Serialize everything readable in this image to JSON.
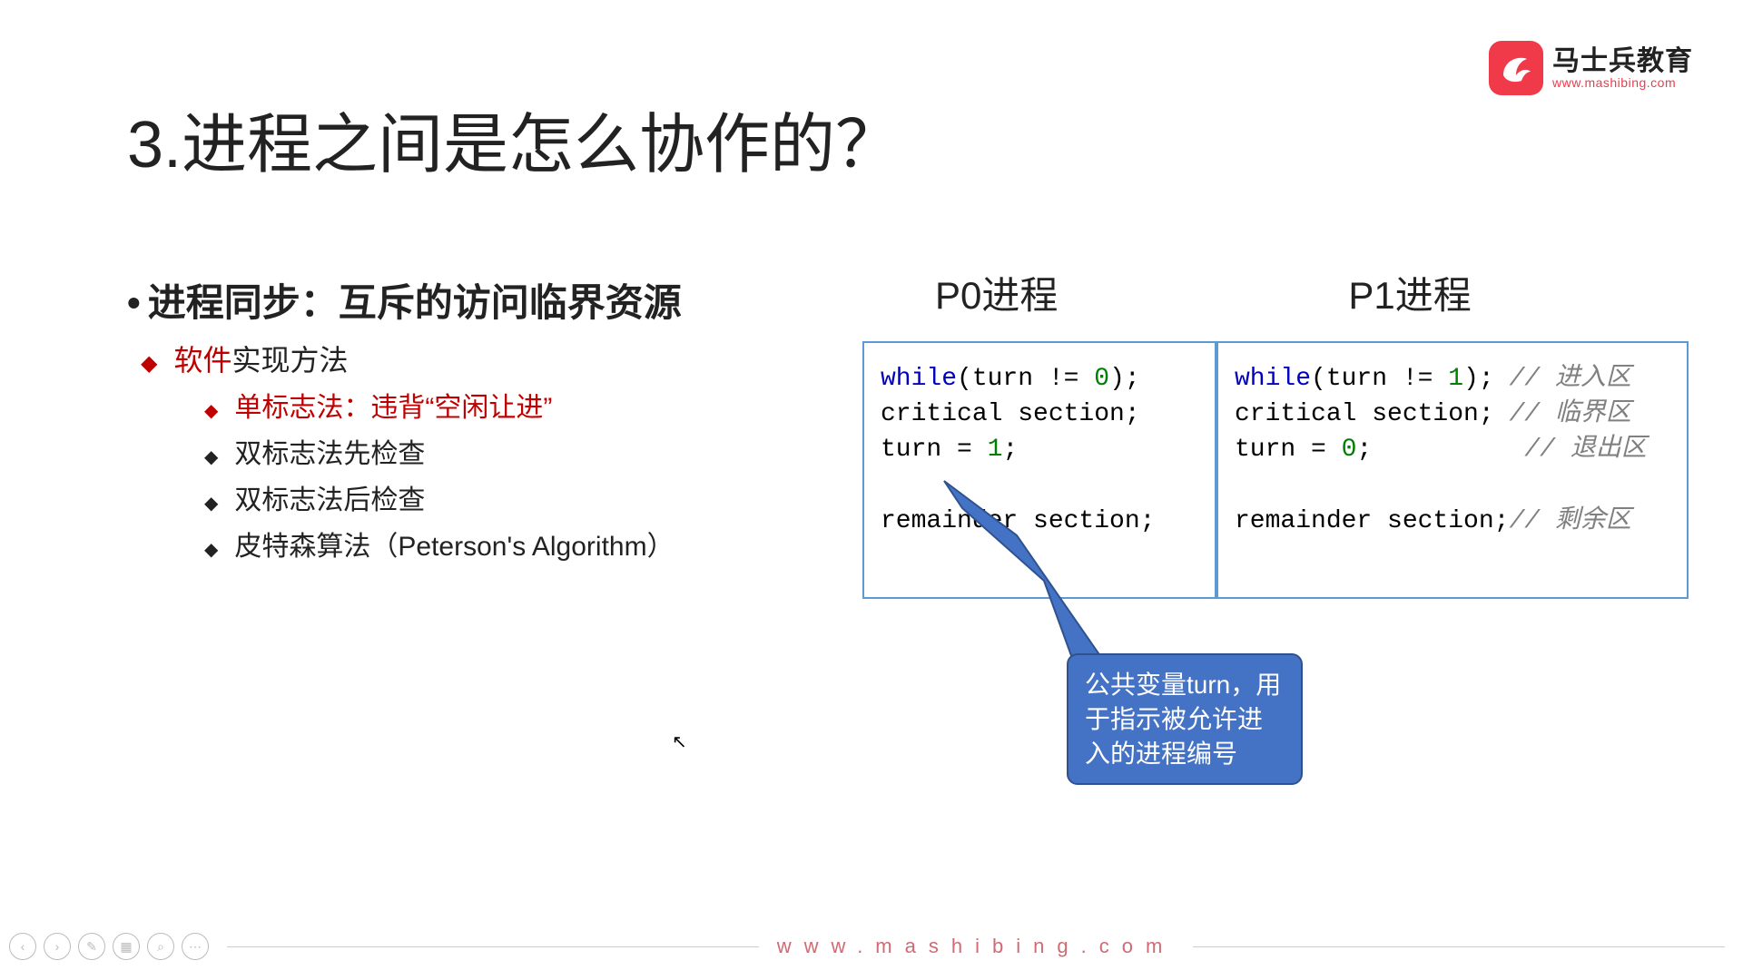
{
  "logo": {
    "cn": "马士兵教育",
    "url": "www.mashibing.com"
  },
  "title": "3.进程之间是怎么协作的？",
  "subtitle": {
    "dot": "•",
    "text": "进程同步：互斥的访问临界资源"
  },
  "list": {
    "l1": {
      "red": "软件",
      "rest": "实现方法"
    },
    "l2": [
      {
        "red": true,
        "text": "单标志法：违背“空闲让进”"
      },
      {
        "red": false,
        "text": "双标志法先检查"
      },
      {
        "red": false,
        "text": "双标志法后检查"
      },
      {
        "red": false,
        "text": "皮特森算法（Peterson's Algorithm）"
      }
    ]
  },
  "proc": {
    "p0": "P0进程",
    "p1": "P1进程"
  },
  "code_p0": {
    "l1a": "while",
    "l1b": "(turn != ",
    "l1c": "0",
    "l1d": ");",
    "l2": "critical section;",
    "l3a": "turn = ",
    "l3b": "1",
    "l3c": ";",
    "l4": "",
    "l5": "remainder section;"
  },
  "code_p1": {
    "l1a": "while",
    "l1b": "(turn != ",
    "l1c": "1",
    "l1d": "); ",
    "l1e": "// 进入区",
    "l2a": "critical section; ",
    "l2b": "// 临界区",
    "l3a": "turn = ",
    "l3b": "0",
    "l3c": ";          ",
    "l3d": "// 退出区",
    "l4": "",
    "l5a": "remainder section;",
    "l5b": "// 剩余区"
  },
  "callout": "公共变量turn，用于指示被允许进入的进程编号",
  "footer_url": "www.mashibing.com"
}
